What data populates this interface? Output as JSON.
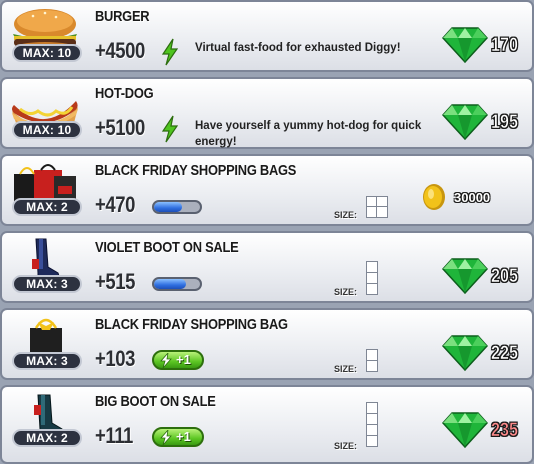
{
  "items": [
    {
      "name": "BURGER",
      "value": "+4500",
      "max": "MAX: 10",
      "description": "Virtual fast-food for exhausted Diggy!",
      "price": "170",
      "currency": "gem",
      "reward": "energy-bolt",
      "thumb": "burger-icon"
    },
    {
      "name": "HOT-DOG",
      "value": "+5100",
      "max": "MAX: 10",
      "description": "Have yourself a yummy hot-dog for quick energy!",
      "price": "195",
      "currency": "gem",
      "reward": "energy-bolt",
      "thumb": "hotdog-icon"
    },
    {
      "name": "BLACK FRIDAY SHOPPING BAGS",
      "value": "+470",
      "max": "MAX: 2",
      "size_label": "SIZE:",
      "price": "30000",
      "currency": "coin",
      "reward": "capacity-bar",
      "thumb": "shopping-bags-icon"
    },
    {
      "name": "VIOLET BOOT ON SALE",
      "value": "+515",
      "max": "MAX: 3",
      "size_label": "SIZE:",
      "price": "205",
      "currency": "gem",
      "reward": "capacity-bar",
      "thumb": "violet-boot-icon"
    },
    {
      "name": "BLACK FRIDAY SHOPPING BAG",
      "value": "+103",
      "max": "MAX: 3",
      "size_label": "SIZE:",
      "pill": "+1",
      "price": "225",
      "currency": "gem",
      "reward": "plus-energy-pill",
      "thumb": "shopping-bag-icon"
    },
    {
      "name": "BIG BOOT ON SALE",
      "value": "+111",
      "max": "MAX: 2",
      "size_label": "SIZE:",
      "pill": "+1",
      "price": "235",
      "price_color": "#ff8a8a",
      "currency": "gem",
      "reward": "plus-energy-pill",
      "thumb": "big-boot-icon"
    }
  ],
  "colors": {
    "gem": "#1fb53a",
    "energy": "#4fc41f",
    "bar": "#2f6fe0",
    "coin": "#f2c21a",
    "insufficient": "#ff8a8a"
  },
  "capacity_bar_levels": [
    0.6,
    0.7
  ]
}
